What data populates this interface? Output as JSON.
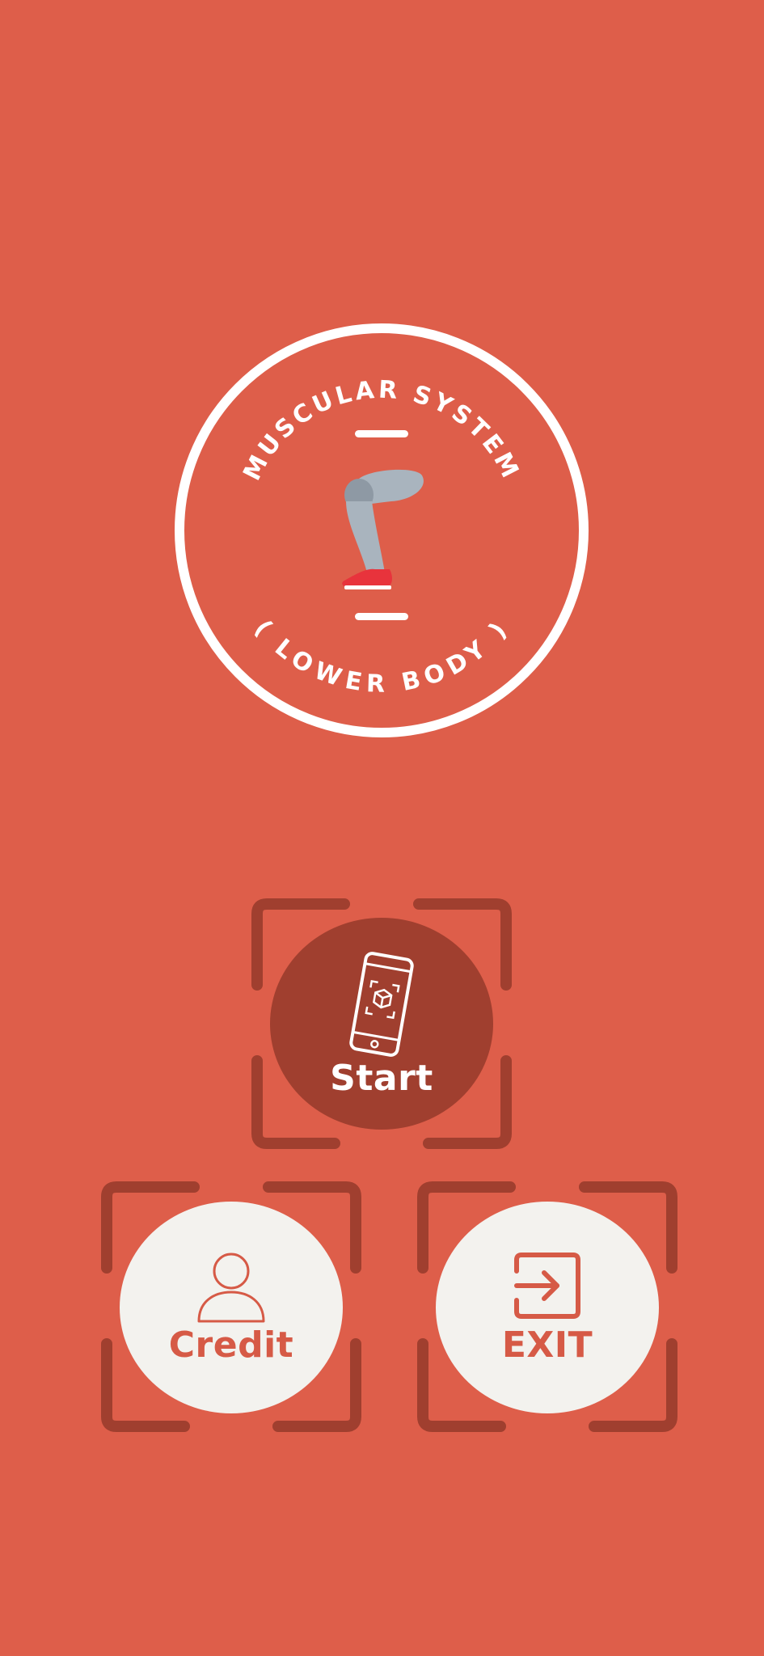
{
  "logo": {
    "top_text": "MUSCULAR SYSTEM",
    "bottom_text": "( LOWER BODY )",
    "icon": "leg-icon"
  },
  "menu": {
    "start": {
      "label": "Start",
      "icon": "phone-ar-icon"
    },
    "credit": {
      "label": "Credit",
      "icon": "person-icon"
    },
    "exit": {
      "label": "EXIT",
      "icon": "exit-icon"
    }
  },
  "colors": {
    "background": "#DE5E4A",
    "frame": "#A03F2F",
    "start_fill": "#A03F2F",
    "secondary_fill": "#F3F2EE",
    "secondary_text": "#D65A46",
    "logo_stroke": "#FFFFFF"
  }
}
